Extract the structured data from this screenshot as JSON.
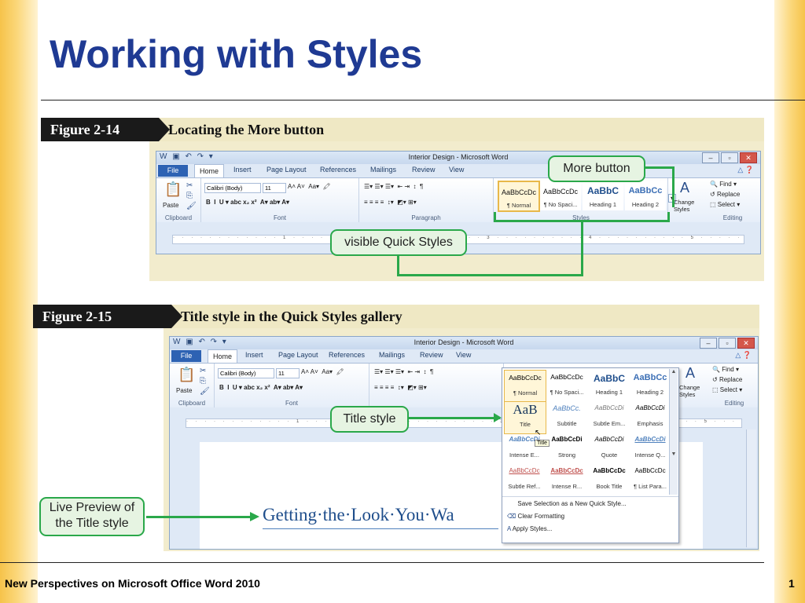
{
  "slide": {
    "title": "Working with Styles",
    "footer": "New Perspectives on Microsoft Office Word 2010",
    "page_number": "1"
  },
  "colors": {
    "title": "#1f3a93",
    "callout_border": "#2aa84a",
    "callout_fill": "#e6f4e2",
    "side_bars": "#f6c34a"
  },
  "figure1": {
    "tag": "Figure 2-14",
    "caption": "Locating the More button",
    "window_title": "Interior Design - Microsoft Word",
    "tabs": [
      "File",
      "Home",
      "Insert",
      "Page Layout",
      "References",
      "Mailings",
      "Review",
      "View"
    ],
    "font_name": "Calibri (Body)",
    "font_size": "11",
    "groups": [
      "Clipboard",
      "Font",
      "Paragraph",
      "Styles",
      "Editing"
    ],
    "paste_label": "Paste",
    "styles": [
      {
        "sample": "AaBbCcDc",
        "name": "¶ Normal"
      },
      {
        "sample": "AaBbCcDc",
        "name": "¶ No Spaci..."
      },
      {
        "sample": "AaBbC",
        "name": "Heading 1"
      },
      {
        "sample": "AaBbCc",
        "name": "Heading 2"
      }
    ],
    "change_styles": "Change Styles",
    "editing": [
      "Find",
      "Replace",
      "Select"
    ],
    "callout_more": "More button",
    "callout_quick": "visible Quick Styles"
  },
  "figure2": {
    "tag": "Figure 2-15",
    "caption": "Title style in the Quick Styles gallery",
    "window_title": "Interior Design - Microsoft Word",
    "tabs": [
      "File",
      "Home",
      "Insert",
      "Page Layout",
      "References",
      "Mailings",
      "Review",
      "View"
    ],
    "font_name": "Calibri (Body)",
    "font_size": "11",
    "groups": [
      "Clipboard",
      "Font",
      "Paragraph",
      "Editing"
    ],
    "paste_label": "Paste",
    "change_styles": "Change Styles",
    "editing": [
      "Find",
      "Replace",
      "Select"
    ],
    "gallery": [
      {
        "sample": "AaBbCcDc",
        "name": "¶ Normal"
      },
      {
        "sample": "AaBbCcDc",
        "name": "¶ No Spaci..."
      },
      {
        "sample": "AaBbC",
        "name": "Heading 1"
      },
      {
        "sample": "AaBbCc",
        "name": "Heading 2"
      },
      {
        "sample": "AaB",
        "name": "Title"
      },
      {
        "sample": "AaBbCc.",
        "name": "Subtitle"
      },
      {
        "sample": "AaBbCcDi",
        "name": "Subtle Em..."
      },
      {
        "sample": "AaBbCcDi",
        "name": "Emphasis"
      },
      {
        "sample": "AaBbCcDi",
        "name": "Intense E..."
      },
      {
        "sample": "AaBbCcDi",
        "name": "Strong"
      },
      {
        "sample": "AaBbCcDi",
        "name": "Quote"
      },
      {
        "sample": "AaBbCcDi",
        "name": "Intense Q..."
      },
      {
        "sample": "AaBbCcDc",
        "name": "Subtle Ref..."
      },
      {
        "sample": "AaBbCcDc",
        "name": "Intense R..."
      },
      {
        "sample": "AaBbCcDc",
        "name": "Book Title"
      },
      {
        "sample": "AaBbCcDc",
        "name": "¶ List Para..."
      }
    ],
    "tooltip": "Title",
    "menu": [
      "Save Selection as a New Quick Style...",
      "Clear Formatting",
      "Apply Styles..."
    ],
    "doc_text": "Getting·the·Look·You·Wa",
    "callout_title": "Title style",
    "callout_preview": "Live Preview of the Title style"
  }
}
